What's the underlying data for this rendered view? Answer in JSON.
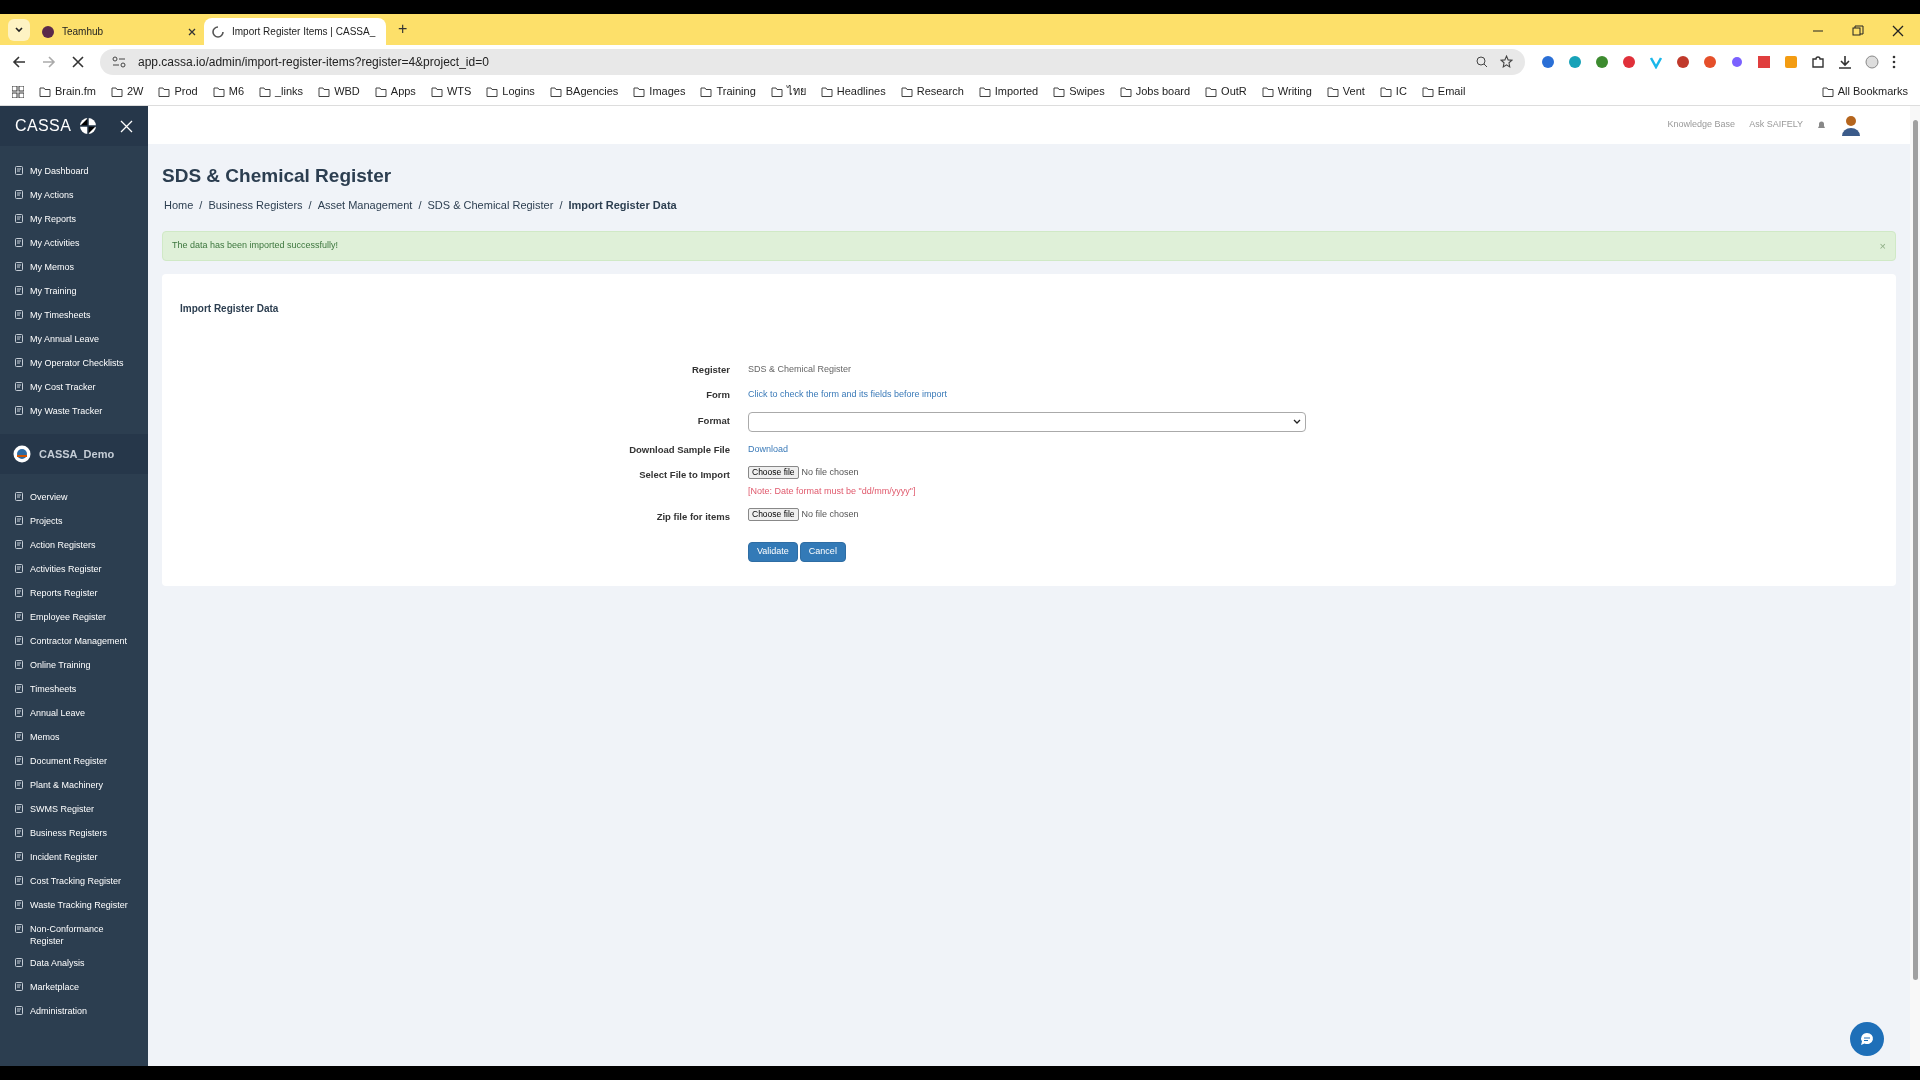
{
  "browser": {
    "tabs": [
      {
        "title": "Teamhub",
        "selected": false
      },
      {
        "title": "Import Register Items | CASSA_",
        "selected": true
      }
    ],
    "url": "app.cassa.io/admin/import-register-items?register=4&project_id=0",
    "bookmarks": [
      "Brain.fm",
      "2W",
      "Prod",
      "M6",
      "_links",
      "WBD",
      "Apps",
      "WTS",
      "Logins",
      "BAgencies",
      "Images",
      "Training",
      "ไทย",
      "Headlines",
      "Research",
      "Imported",
      "Swipes",
      "Jobs board",
      "OutR",
      "Writing",
      "Vent",
      "IC",
      "Email"
    ],
    "all_bookmarks": "All Bookmarks",
    "new_tab": "+"
  },
  "sidebar": {
    "brand": "CASSA",
    "personal_items": [
      "My Dashboard",
      "My Actions",
      "My Reports",
      "My Activities",
      "My Memos",
      "My Training",
      "My Timesheets",
      "My Annual Leave",
      "My Operator Checklists",
      "My Cost Tracker",
      "My Waste Tracker"
    ],
    "workspace": "CASSA_Demo",
    "items": [
      "Overview",
      "Projects",
      "Action Registers",
      "Activities Register",
      "Reports Register",
      "Employee Register",
      "Contractor Management",
      "Online Training",
      "Timesheets",
      "Annual Leave",
      "Memos",
      "Document Register",
      "Plant & Machinery",
      "SWMS Register",
      "Business Registers",
      "Incident Register",
      "Cost Tracking Register",
      "Waste Tracking Register",
      "Non-Conformance Register",
      "Data Analysis",
      "Marketplace",
      "Administration"
    ]
  },
  "header": {
    "links": [
      "Knowledge Base",
      "Ask SAIFELY"
    ]
  },
  "page": {
    "title": "SDS & Chemical Register",
    "breadcrumbs": [
      "Home",
      "Business Registers",
      "Asset Management",
      "SDS & Chemical Register",
      "Import Register Data"
    ],
    "breadcrumb_separator": "/",
    "alert": "The data has been imported successfully!",
    "alert_close": "×"
  },
  "card": {
    "title": "Import Register Data",
    "rows": [
      {
        "kind": "text",
        "label": "Register",
        "value": "SDS & Chemical Register"
      },
      {
        "kind": "link",
        "label": "Form",
        "value": "Click to check the form and its fields before import"
      },
      {
        "kind": "select",
        "label": "Format"
      },
      {
        "kind": "link",
        "label": "Download Sample File",
        "value": "Download"
      },
      {
        "kind": "file",
        "label": "Select File to Import",
        "button": "Choose file",
        "value": "No file chosen",
        "note": "[Note: Date format must be \"dd/mm/yyyy\"]"
      },
      {
        "kind": "file",
        "label": "Zip file for items",
        "button": "Choose file",
        "value": "No file chosen"
      }
    ],
    "buttons": [
      "Validate",
      "Cancel"
    ]
  }
}
